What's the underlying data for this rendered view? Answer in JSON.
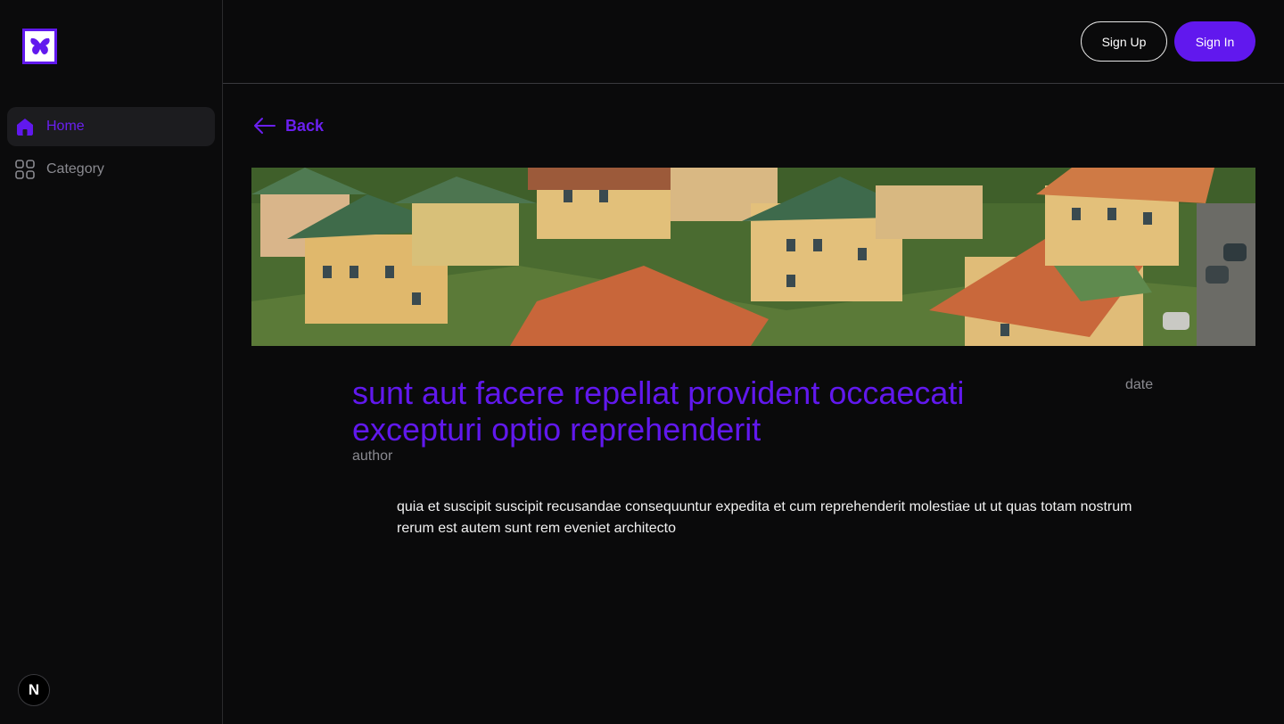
{
  "sidebar": {
    "logo_icon": "butterfly-logo-icon",
    "items": [
      {
        "label": "Home",
        "icon": "home-icon",
        "active": true
      },
      {
        "label": "Category",
        "icon": "grid-icon",
        "active": false
      }
    ],
    "badge": "N"
  },
  "header": {
    "signup_label": "Sign Up",
    "signin_label": "Sign In"
  },
  "back": {
    "label": "Back",
    "icon": "arrow-left-icon"
  },
  "post": {
    "title": "sunt aut facere repellat provident occaecati excepturi optio reprehenderit",
    "date": "date",
    "author": "author",
    "body": "quia et suscipit suscipit recusandae consequuntur expedita et cum reprehenderit molestiae ut ut quas totam nostrum rerum est autem sunt rem eveniet architecto"
  },
  "colors": {
    "accent": "#6118ee",
    "background": "#0a0a0b",
    "muted": "#8a8a90"
  }
}
